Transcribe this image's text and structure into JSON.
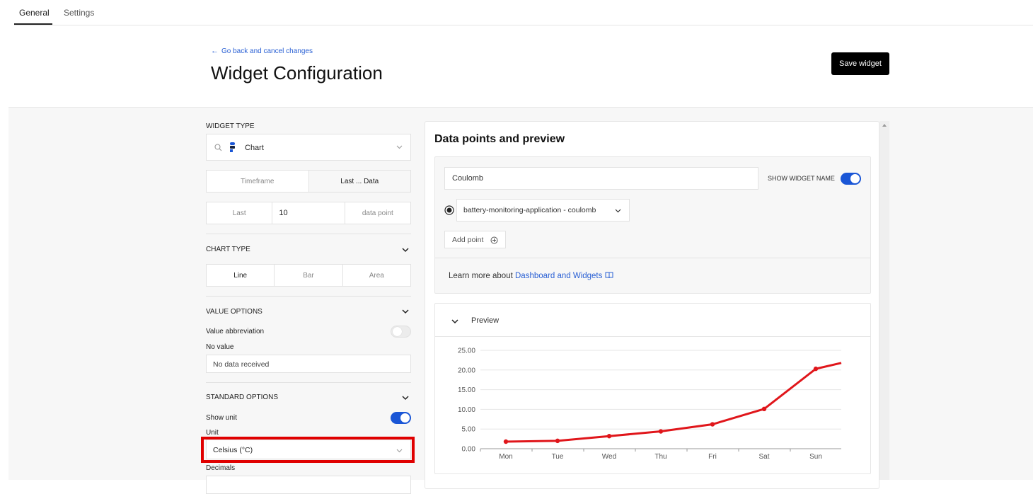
{
  "tabs": [
    {
      "label": "General"
    },
    {
      "label": "Settings"
    }
  ],
  "back_link": "Go back and cancel changes",
  "page_title": "Widget Configuration",
  "save_button": "Save widget",
  "left": {
    "widget_type_label": "WIDGET TYPE",
    "widget_type_value": "Chart",
    "timeframe_tabs": [
      "Timeframe",
      "Last ... Data"
    ],
    "last_label": "Last",
    "last_value": "10",
    "last_unit": "data point",
    "chart_type_label": "CHART TYPE",
    "chart_types": [
      "Line",
      "Bar",
      "Area"
    ],
    "value_options_label": "VALUE OPTIONS",
    "value_abbreviation_label": "Value abbreviation",
    "no_value_label": "No value",
    "no_value_value": "No data received",
    "standard_options_label": "STANDARD OPTIONS",
    "show_unit_label": "Show unit",
    "unit_label": "Unit",
    "unit_value": "Celsius (°C)",
    "decimals_label": "Decimals"
  },
  "right": {
    "title": "Data points and preview",
    "widget_name_value": "Coulomb",
    "show_widget_name_label": "SHOW WIDGET NAME",
    "datapoint_select": "battery-monitoring-application - coulomb",
    "add_point": "Add point",
    "learn_more_prefix": "Learn more about",
    "learn_more_link": "Dashboard and Widgets",
    "preview_label": "Preview"
  },
  "colors": {
    "accent": "#1a56d6",
    "line": "#e0161b",
    "link": "#2a60d4"
  },
  "chart_data": {
    "type": "line",
    "categories": [
      "Mon",
      "Tue",
      "Wed",
      "Thu",
      "Fri",
      "Sat",
      "Sun"
    ],
    "series": [
      {
        "values": [
          1.8,
          2.0,
          3.2,
          4.4,
          6.2,
          10.1,
          20.3,
          21.8
        ]
      }
    ],
    "y_ticks": [
      "0.00",
      "5.00",
      "10.00",
      "15.00",
      "20.00",
      "25.00"
    ],
    "ylim": [
      0,
      25
    ],
    "grid": true
  }
}
